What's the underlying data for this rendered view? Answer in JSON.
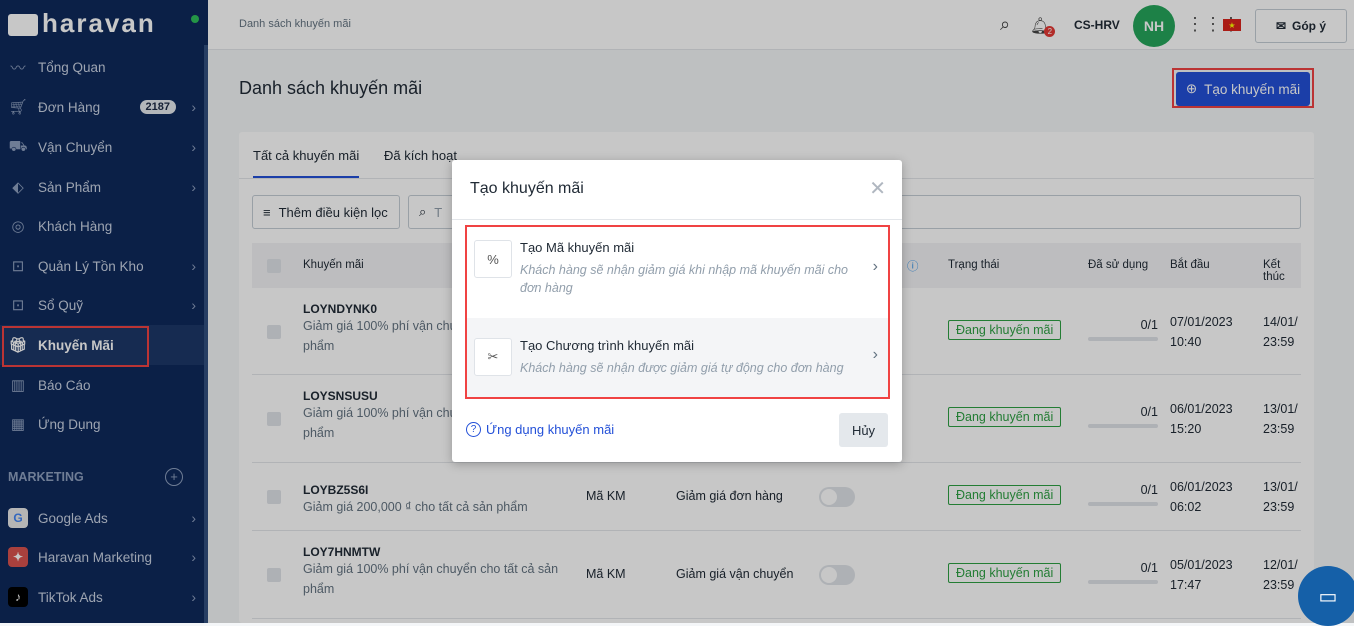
{
  "brand": {
    "logo": "haravan"
  },
  "sidebar": {
    "items": [
      {
        "label": "Tổng Quan",
        "icon": "chart-line-icon"
      },
      {
        "label": "Đơn Hàng",
        "icon": "cart-icon",
        "badge": "2187"
      },
      {
        "label": "Vận Chuyển",
        "icon": "truck-icon"
      },
      {
        "label": "Sản Phẩm",
        "icon": "tag-icon"
      },
      {
        "label": "Khách Hàng",
        "icon": "user-circle-icon"
      },
      {
        "label": "Quản Lý Tồn Kho",
        "icon": "inventory-icon"
      },
      {
        "label": "Sổ Quỹ",
        "icon": "cashbook-icon"
      },
      {
        "label": "Khuyến Mãi",
        "icon": "gift-icon"
      },
      {
        "label": "Báo Cáo",
        "icon": "report-icon"
      },
      {
        "label": "Ứng Dụng",
        "icon": "apps-icon"
      }
    ],
    "marketing_label": "MARKETING",
    "marketing": [
      {
        "label": "Google Ads"
      },
      {
        "label": "Haravan Marketing"
      },
      {
        "label": "TikTok Ads"
      }
    ]
  },
  "header": {
    "breadcrumb": "Danh sách khuyến mãi",
    "notif_count": "2",
    "store": "CS-HRV",
    "avatar": "NH",
    "feedback": "Góp ý"
  },
  "page": {
    "title": "Danh sách khuyến mãi",
    "create_button": "Tạo khuyến mãi",
    "tabs": [
      "Tất cả khuyến mãi",
      "Đã kích hoạt"
    ],
    "filter_button": "Thêm điều kiện lọc",
    "search_placeholder": "T"
  },
  "table": {
    "columns": [
      "Khuyến mãi",
      "Trạng thái",
      "Đã sử dụng",
      "Bắt đầu",
      "Kết thúc"
    ],
    "rows": [
      {
        "code": "LOYNDYNK0",
        "desc": "Giảm giá 100% phí vận chu",
        "desc2": "phẩm",
        "kind": "",
        "type": "",
        "status": "Đang khuyến mãi",
        "used": "0/1",
        "start_date": "07/01/2023",
        "start_time": "10:40",
        "end_date": "14/01/",
        "end_time": "23:59"
      },
      {
        "code": "LOYSNSUSU",
        "desc": "Giảm giá 100% phí vận chu",
        "desc2": "phẩm",
        "kind": "",
        "type": "",
        "status": "Đang khuyến mãi",
        "used": "0/1",
        "start_date": "06/01/2023",
        "start_time": "15:20",
        "end_date": "13/01/",
        "end_time": "23:59"
      },
      {
        "code": "LOYBZ5S6I",
        "desc": "Giảm giá 200,000 ₫ cho tất cả sản phẩm",
        "desc2": "",
        "kind": "Mã KM",
        "type": "Giảm giá đơn hàng",
        "status": "Đang khuyến mãi",
        "used": "0/1",
        "start_date": "06/01/2023",
        "start_time": "06:02",
        "end_date": "13/01/",
        "end_time": "23:59"
      },
      {
        "code": "LOY7HNMTW",
        "desc": "Giảm giá 100% phí vận chuyển cho tất cả sản",
        "desc2": "phẩm",
        "kind": "Mã KM",
        "type": "Giảm giá vận chuyển",
        "status": "Đang khuyến mãi",
        "used": "0/1",
        "start_date": "05/01/2023",
        "start_time": "17:47",
        "end_date": "12/01/",
        "end_time": "23:59"
      }
    ]
  },
  "modal": {
    "title": "Tạo khuyến mãi",
    "options": [
      {
        "title": "Tạo Mã khuyến mãi",
        "desc": "Khách hàng sẽ nhận giảm giá khi nhập mã khuyến mãi cho đơn hàng"
      },
      {
        "title": "Tạo Chương trình khuyến mãi",
        "desc": "Khách hàng sẽ nhận được giảm giá tự động cho đơn hàng"
      }
    ],
    "help_link": "Ứng dụng khuyến mãi",
    "cancel": "Hủy"
  },
  "colors": {
    "sidebar": "#0f2a5c",
    "primary": "#2350d8",
    "success": "#2ea043",
    "highlight": "#f04343"
  }
}
